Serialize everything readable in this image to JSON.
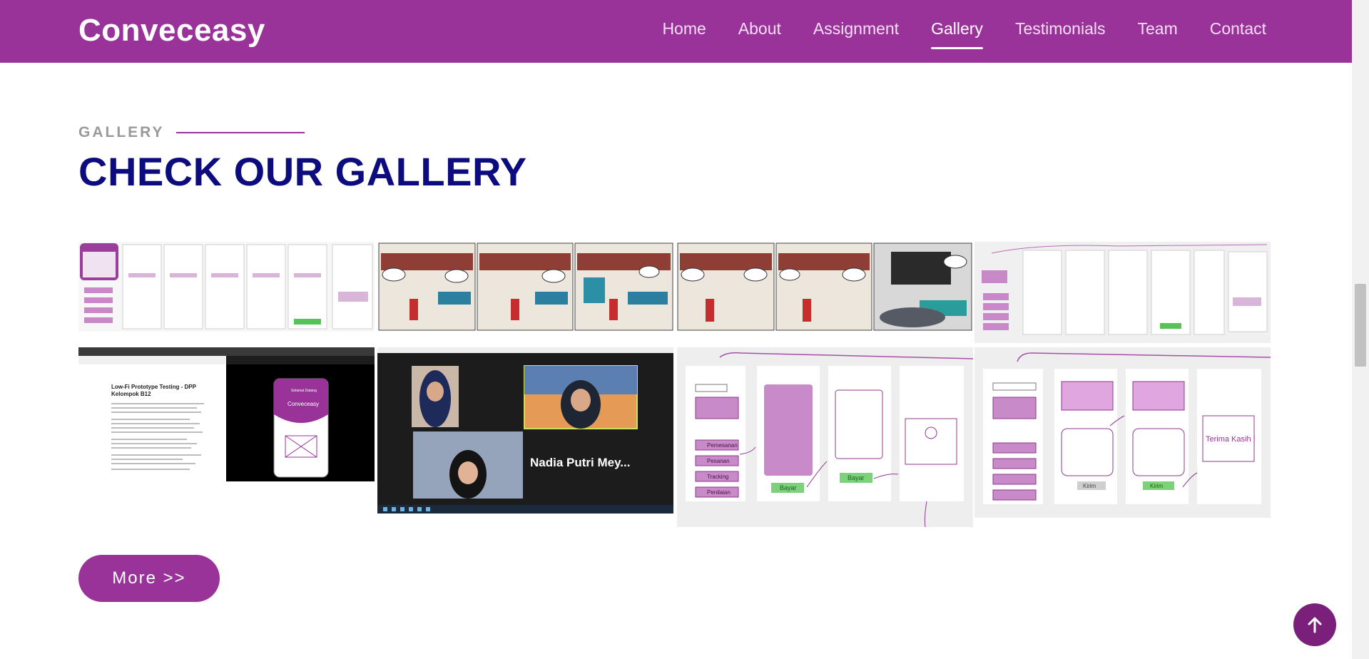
{
  "header": {
    "brand": "Conveceasy",
    "nav": [
      {
        "label": "Home"
      },
      {
        "label": "About"
      },
      {
        "label": "Assignment"
      },
      {
        "label": "Gallery",
        "active": true
      },
      {
        "label": "Testimonials"
      },
      {
        "label": "Team"
      },
      {
        "label": "Contact"
      }
    ]
  },
  "section": {
    "eyebrow": "GALLERY",
    "title": "CHECK OUR GALLERY"
  },
  "gallery": {
    "doc_title": "Low-Fi Prototype Testing - DPP Kelompok B12",
    "phone_app_name": "Conveceasy",
    "phone_header": "Selamat Datang",
    "zoom_participant": "Nadia Putri Mey...",
    "wireframe_menu": [
      "Pemesanan",
      "Pesanan",
      "Tracking",
      "Penilaian"
    ],
    "wireframe_buttons": [
      "Bayar",
      "Kirim"
    ],
    "wireframe_thanks": "Terima Kasih !"
  },
  "more_button": "More >>",
  "icons": {
    "back_to_top": "arrow-up-icon"
  },
  "colors": {
    "brand": "#993399",
    "title": "#0c0c7e",
    "back_to_top": "#7a1f7a"
  }
}
